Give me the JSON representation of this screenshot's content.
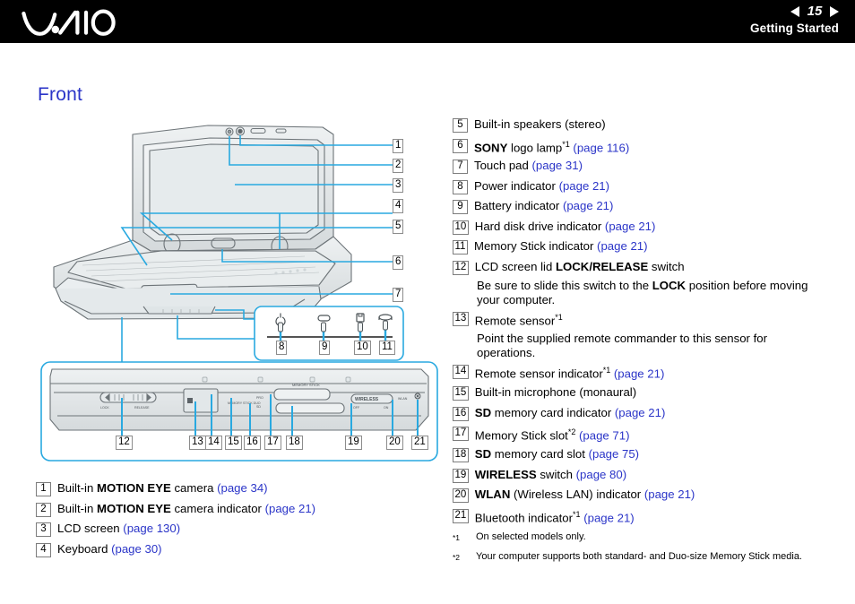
{
  "header": {
    "logo_alt": "VAIO",
    "page_number": "15",
    "chapter": "Getting Started",
    "prev_arrow": "prev-page-arrow",
    "next_arrow": "next-page-arrow"
  },
  "page": {
    "title": "Front"
  },
  "illustration": {
    "labels": {
      "lock": "LOCK",
      "release": "RELEASE",
      "memory_stick": "MEMORY STICK",
      "memory_stick_duo": "MEMORY STICK DUO",
      "pro": "PRO",
      "sd": "SD",
      "wireless": "WIRELESS",
      "off": "OFF",
      "on": "ON",
      "wlan": "WLAN"
    },
    "indicator_detail": {
      "items": [
        {
          "num": "8",
          "icon": "power-indicator-icon"
        },
        {
          "num": "9",
          "icon": "battery-indicator-icon"
        },
        {
          "num": "10",
          "icon": "hard-disk-indicator-icon"
        },
        {
          "num": "11",
          "icon": "memory-stick-indicator-icon"
        }
      ]
    },
    "callout_numbers_top": [
      "1",
      "2",
      "3",
      "4",
      "5",
      "6",
      "7"
    ],
    "callout_numbers_front": [
      "12",
      "13",
      "14",
      "15",
      "16",
      "17",
      "18",
      "19",
      "20",
      "21"
    ]
  },
  "left_list": [
    {
      "num": "1",
      "pre": "Built-in ",
      "bold": "MOTION EYE",
      "post": " camera ",
      "link": "(page 34)"
    },
    {
      "num": "2",
      "pre": "Built-in ",
      "bold": "MOTION EYE",
      "post": " camera indicator ",
      "link": "(page 21)"
    },
    {
      "num": "3",
      "pre": "LCD screen ",
      "bold": "",
      "post": "",
      "link": "(page 130)"
    },
    {
      "num": "4",
      "pre": "Keyboard ",
      "bold": "",
      "post": "",
      "link": "(page 30)"
    }
  ],
  "right_list": [
    {
      "num": "5",
      "pre": "Built-in speakers (stereo)",
      "bold": "",
      "post": "",
      "sup": "",
      "link": ""
    },
    {
      "num": "6",
      "pre": "",
      "bold": "SONY",
      "post": " logo lamp",
      "sup": "*1",
      "link": "(page 116)"
    },
    {
      "num": "7",
      "pre": "Touch pad ",
      "bold": "",
      "post": "",
      "sup": "",
      "link": "(page 31)"
    },
    {
      "num": "8",
      "pre": "Power indicator ",
      "bold": "",
      "post": "",
      "sup": "",
      "link": "(page 21)"
    },
    {
      "num": "9",
      "pre": "Battery indicator ",
      "bold": "",
      "post": "",
      "sup": "",
      "link": "(page 21)"
    },
    {
      "num": "10",
      "pre": "Hard disk drive indicator ",
      "bold": "",
      "post": "",
      "sup": "",
      "link": "(page 21)"
    },
    {
      "num": "11",
      "pre": "Memory Stick indicator ",
      "bold": "",
      "post": "",
      "sup": "",
      "link": "(page 21)"
    },
    {
      "num": "12",
      "pre": "LCD screen lid ",
      "bold": "LOCK/RELEASE",
      "post": " switch",
      "sup": "",
      "link": ""
    },
    {
      "num": "13",
      "pre": "Remote sensor",
      "bold": "",
      "post": "",
      "sup": "*1",
      "link": ""
    },
    {
      "num": "14",
      "pre": "Remote sensor indicator",
      "bold": "",
      "post": "",
      "sup": "*1",
      "link": " (page 21)"
    },
    {
      "num": "15",
      "pre": "Built-in microphone (monaural)",
      "bold": "",
      "post": "",
      "sup": "",
      "link": ""
    },
    {
      "num": "16",
      "pre": "",
      "bold": "SD",
      "post": " memory card indicator ",
      "sup": "",
      "link": "(page 21)"
    },
    {
      "num": "17",
      "pre": "Memory Stick slot",
      "bold": "",
      "post": "",
      "sup": "*2",
      "link": " (page 71)"
    },
    {
      "num": "18",
      "pre": "",
      "bold": "SD",
      "post": " memory card slot ",
      "sup": "",
      "link": "(page 75)"
    },
    {
      "num": "19",
      "pre": "",
      "bold": "WIRELESS",
      "post": " switch ",
      "sup": "",
      "link": "(page 80)"
    },
    {
      "num": "20",
      "pre": "",
      "bold": "WLAN",
      "post": " (Wireless LAN) indicator ",
      "sup": "",
      "link": "(page 21)"
    },
    {
      "num": "21",
      "pre": "Bluetooth indicator",
      "bold": "",
      "post": "",
      "sup": "*1",
      "link": " (page 21)"
    }
  ],
  "right_notes": {
    "note_12_a": "Be sure to slide this switch to the ",
    "note_12_bold": "LOCK",
    "note_12_b": " position before moving",
    "note_12_c": "your computer.",
    "note_13_a": "Point the supplied remote commander to this sensor for",
    "note_13_b": "operations."
  },
  "footnotes": [
    {
      "mark": "*1",
      "text": "On selected models only."
    },
    {
      "mark": "*2",
      "text": "Your computer supports both standard- and Duo-size Memory Stick media."
    }
  ],
  "colors": {
    "link_blue": "#2b35c8",
    "illustration_blue": "#29a9e0",
    "header_black": "#000000"
  }
}
